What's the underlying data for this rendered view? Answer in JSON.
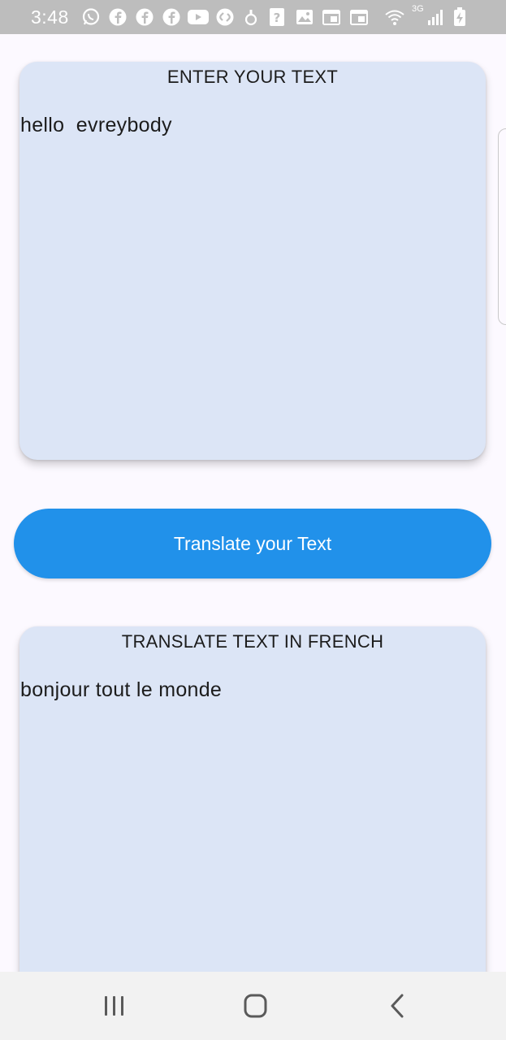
{
  "status_bar": {
    "time": "3:48",
    "network": "3G",
    "notification_icons": [
      "whatsapp-icon",
      "facebook-icon",
      "facebook-icon",
      "facebook-icon",
      "youtube-icon",
      "shazam-icon",
      "vpn-key-icon",
      "unknown-app-icon",
      "gallery-icon",
      "calendar-icon",
      "calendar-icon"
    ],
    "system_icons": [
      "wifi-icon",
      "signal-icon",
      "battery-charging-icon"
    ]
  },
  "input_card": {
    "title": "ENTER YOUR TEXT",
    "value": "hello  evreybody"
  },
  "translate_button": {
    "label": "Translate your Text",
    "color": "#2191ea"
  },
  "output_card": {
    "title": "TRANSLATE TEXT IN FRENCH",
    "value": "bonjour tout le monde"
  },
  "colors": {
    "card_background": "#dce5f6",
    "page_background": "#fcf9ff"
  },
  "nav_bar": {
    "items": [
      "recent-apps-icon",
      "home-icon",
      "back-icon"
    ]
  }
}
